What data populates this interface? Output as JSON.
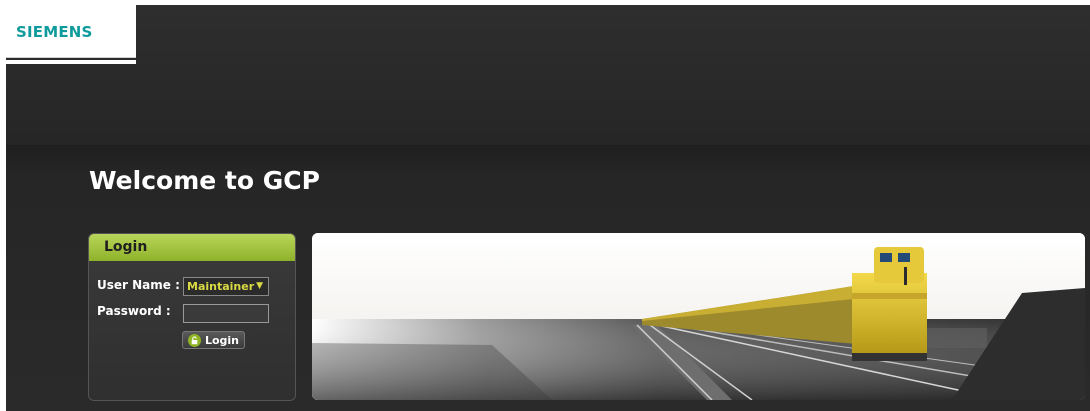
{
  "brand": {
    "name": "SIEMENS"
  },
  "page": {
    "welcome": "Welcome to GCP"
  },
  "login": {
    "title": "Login",
    "username_label": "User Name :",
    "username_value": "Maintainer",
    "password_label": "Password :",
    "password_value": "",
    "button_label": "Login"
  },
  "colors": {
    "brand_teal": "#0f9b9b",
    "login_header_green": "#a5c440",
    "select_text": "#d9d943",
    "background_dark": "#2b2b2b"
  },
  "icons": {
    "login_button": "lock-icon",
    "select_arrow": "chevron-down-icon"
  }
}
